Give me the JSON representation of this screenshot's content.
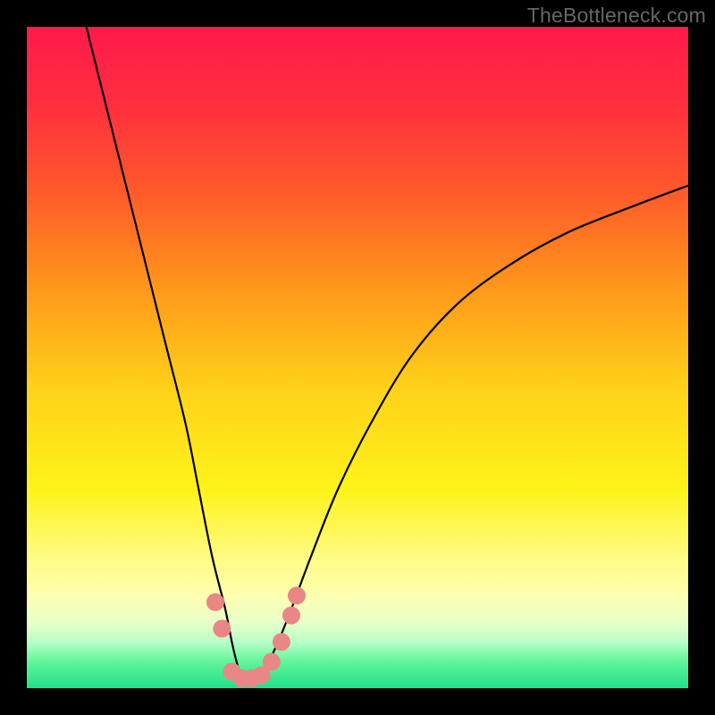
{
  "watermark": "TheBottleneck.com",
  "chart_data": {
    "type": "line",
    "title": "",
    "xlabel": "",
    "ylabel": "",
    "xlim": [
      0,
      100
    ],
    "ylim": [
      0,
      100
    ],
    "background_gradient": {
      "stops": [
        {
          "offset": 0.0,
          "color": "#ff1a4a"
        },
        {
          "offset": 0.12,
          "color": "#ff2f3f"
        },
        {
          "offset": 0.25,
          "color": "#ff5a2a"
        },
        {
          "offset": 0.4,
          "color": "#ff9a1a"
        },
        {
          "offset": 0.55,
          "color": "#ffd21a"
        },
        {
          "offset": 0.7,
          "color": "#fff31a"
        },
        {
          "offset": 0.8,
          "color": "#fffb80"
        },
        {
          "offset": 0.86,
          "color": "#fdffb0"
        },
        {
          "offset": 0.9,
          "color": "#e8ffc8"
        },
        {
          "offset": 0.93,
          "color": "#b8ffc8"
        },
        {
          "offset": 0.96,
          "color": "#60f59a"
        },
        {
          "offset": 1.0,
          "color": "#20e089"
        }
      ]
    },
    "series": [
      {
        "name": "bottleneck-curve",
        "x": [
          9,
          12,
          15,
          18,
          21,
          24,
          26,
          28,
          30,
          31,
          32,
          33,
          34,
          36,
          38,
          40,
          43,
          47,
          52,
          58,
          65,
          73,
          82,
          92,
          100
        ],
        "y": [
          100,
          88,
          76,
          64,
          52,
          40,
          30,
          20,
          12,
          7,
          3,
          1,
          1,
          3,
          7,
          12,
          20,
          30,
          40,
          50,
          58,
          64,
          69,
          73,
          76
        ]
      }
    ],
    "markers": {
      "name": "highlight-points",
      "color": "#e98787",
      "radius": 10,
      "points": [
        {
          "x": 28.5,
          "y": 13
        },
        {
          "x": 29.5,
          "y": 9
        },
        {
          "x": 31.0,
          "y": 2.5
        },
        {
          "x": 32.5,
          "y": 1.5
        },
        {
          "x": 34.0,
          "y": 1.5
        },
        {
          "x": 35.5,
          "y": 2.0
        },
        {
          "x": 37.0,
          "y": 4.0
        },
        {
          "x": 38.5,
          "y": 7.0
        },
        {
          "x": 40.0,
          "y": 11.0
        },
        {
          "x": 40.8,
          "y": 14.0
        }
      ]
    }
  }
}
